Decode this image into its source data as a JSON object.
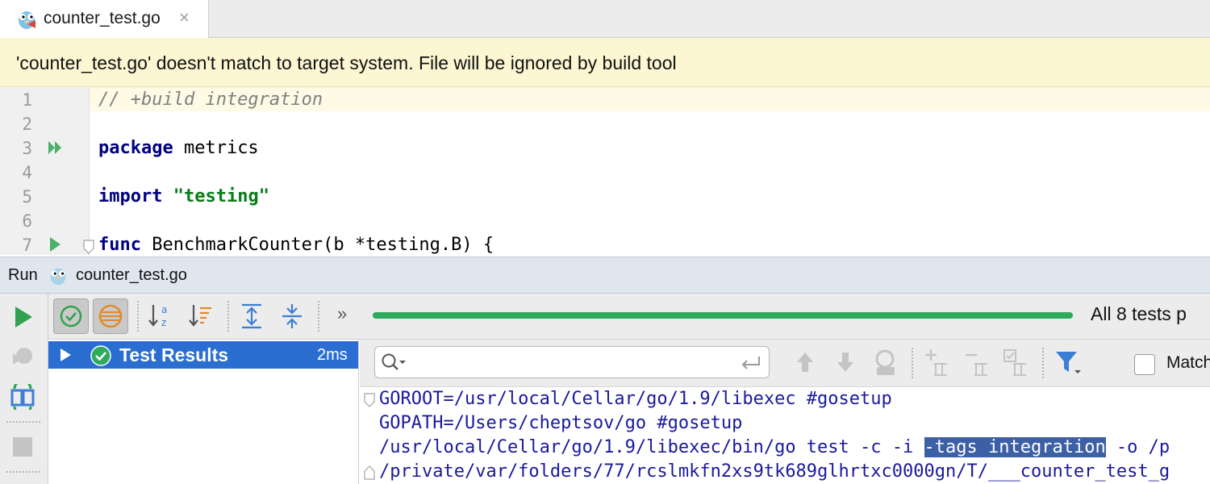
{
  "tab": {
    "title": "counter_test.go",
    "close": "×"
  },
  "banner": {
    "message": "'counter_test.go' doesn't match to target system. File will be ignored by build tool"
  },
  "editor": {
    "line_numbers": [
      "1",
      "2",
      "3",
      "4",
      "5",
      "6",
      "7"
    ],
    "line1": {
      "comment": "// +build integration"
    },
    "line3": {
      "keyword": "package",
      "rest": " metrics"
    },
    "line5": {
      "keyword": "import",
      "space": " ",
      "string": "\"testing\""
    },
    "line7": {
      "keyword": "func",
      "rest": " BenchmarkCounter(b *testing.B) {"
    }
  },
  "run_panel": {
    "label": "Run",
    "file": "counter_test.go",
    "more": "»",
    "progress": 1.0,
    "status": "All 8 tests p"
  },
  "test_tree": {
    "root_label": "Test Results",
    "duration": "2ms"
  },
  "console_toolbar": {
    "search_placeholder": "",
    "match_case_label": "Match"
  },
  "console": {
    "line1": "GOROOT=/usr/local/Cellar/go/1.9/libexec #gosetup",
    "line2": "GOPATH=/Users/cheptsov/go #gosetup",
    "line3_before": "/usr/local/Cellar/go/1.9/libexec/bin/go test -c -i ",
    "line3_selected": "-tags integration",
    "line3_after": " -o /p",
    "line4": "/private/var/folders/77/rcslmkfn2xs9tk689glhrtxc0000gn/T/___counter_test_g"
  },
  "colors": {
    "accent_selection": "#2a6ed2",
    "progress_green": "#2faa5c",
    "warning_banner": "#fcf7d2",
    "keyword": "#000080",
    "string": "#067d17"
  }
}
